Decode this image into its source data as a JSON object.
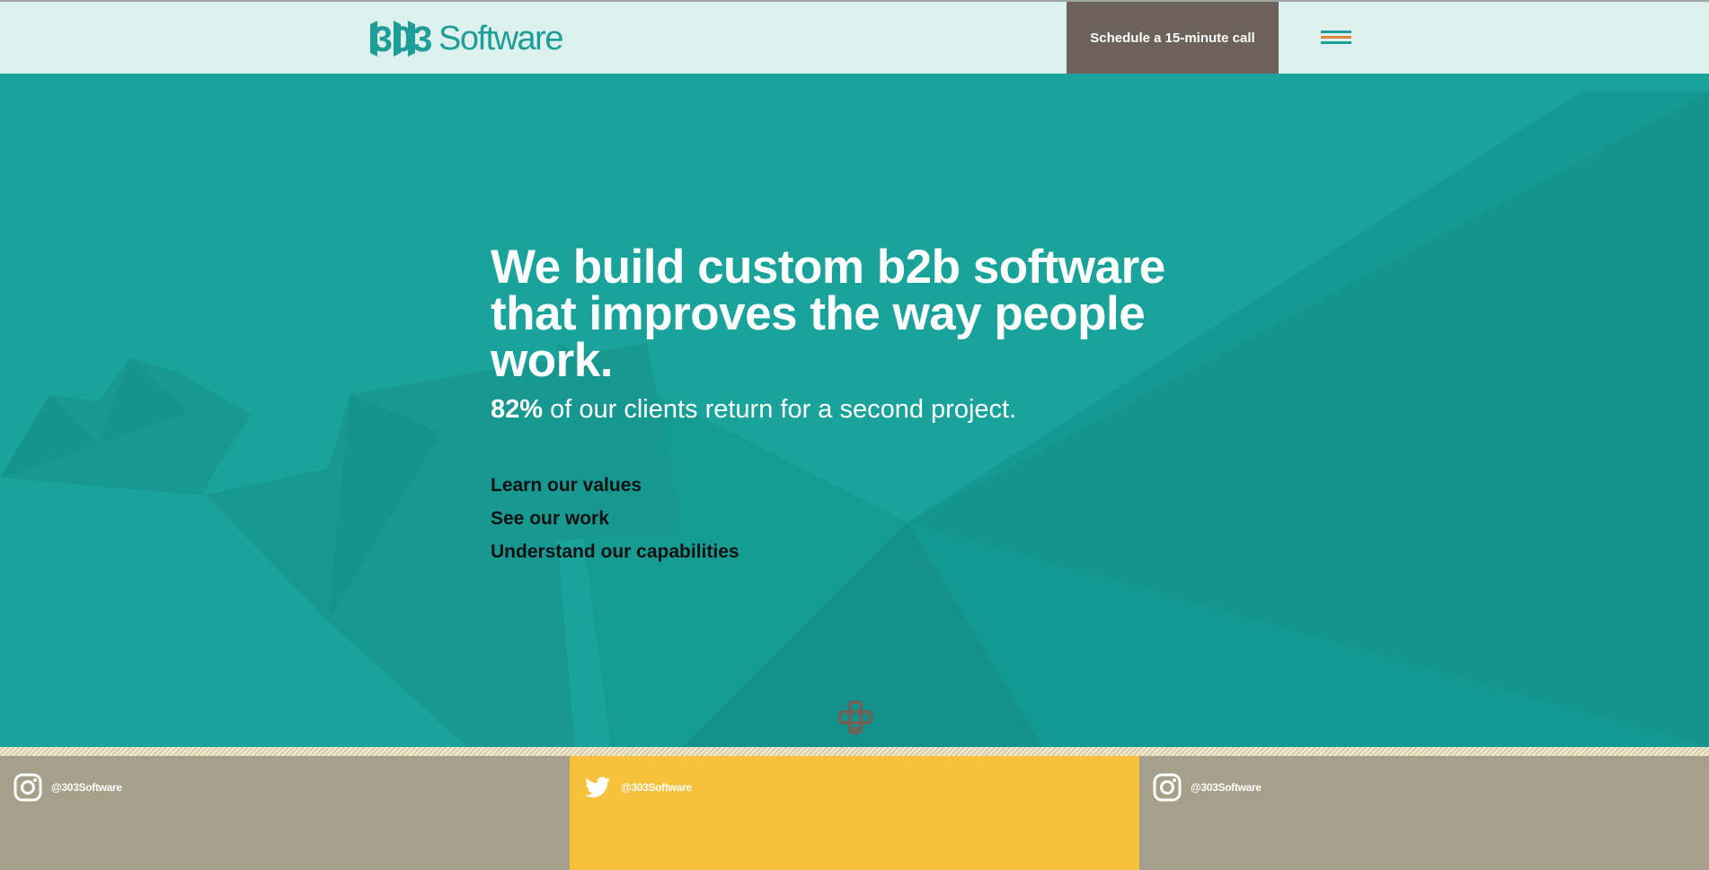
{
  "header": {
    "logo_numbers": "303",
    "logo_text": "Software",
    "cta_label": "Schedule a 15-minute call",
    "menu_icon": "hamburger-menu-icon"
  },
  "hero": {
    "headline": "We build custom b2b software that improves the way people work.",
    "stat_value": "82%",
    "stat_text": " of our clients return for a second project.",
    "links": [
      {
        "label": "Learn our values"
      },
      {
        "label": "See our work"
      },
      {
        "label": "Understand our capabilities"
      }
    ],
    "scroll_icon": "scroll-down-icon"
  },
  "footer": {
    "social": [
      {
        "icon": "instagram-icon",
        "handle": "@303Software"
      },
      {
        "icon": "twitter-icon",
        "handle": "@303Software"
      },
      {
        "icon": "instagram-icon",
        "handle": "@303Software"
      }
    ]
  },
  "colors": {
    "teal": "#19a39b",
    "header_bg": "#dcf0ee",
    "cta_bg": "#6d625a",
    "footer_tan": "#a69f89",
    "footer_yellow": "#f7c13b",
    "menu_orange": "#e3823a"
  }
}
